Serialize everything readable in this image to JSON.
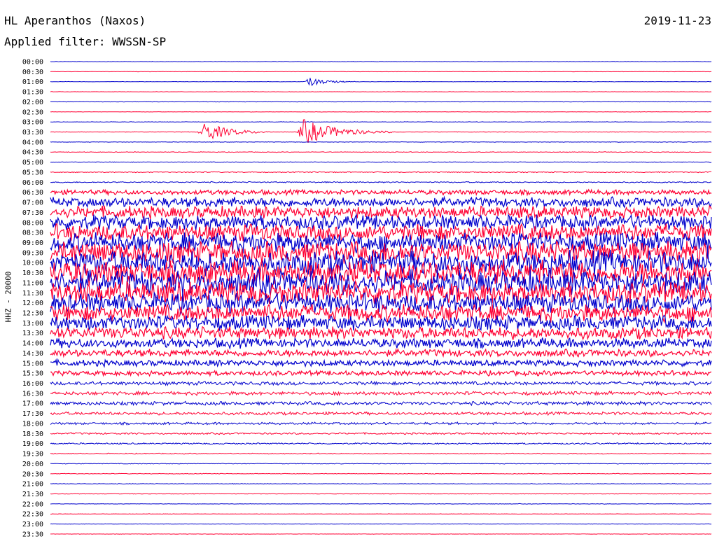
{
  "header": {
    "station": "HL Aperanthos (Naxos)",
    "date": "2019-11-23",
    "filter": "Applied filter: WWSSN-SP"
  },
  "chart_data": {
    "type": "line",
    "title": "HL Aperanthos (Naxos)",
    "ylabel": "HHZ - 20000",
    "row_times": [
      "00:00",
      "00:30",
      "01:00",
      "01:30",
      "02:00",
      "02:30",
      "03:00",
      "03:30",
      "04:00",
      "04:30",
      "05:00",
      "05:30",
      "06:00",
      "06:30",
      "07:00",
      "07:30",
      "08:00",
      "08:30",
      "09:00",
      "09:30",
      "10:00",
      "10:30",
      "11:00",
      "11:30",
      "12:00",
      "12:30",
      "13:00",
      "13:30",
      "14:00",
      "14:30",
      "15:00",
      "15:30",
      "16:00",
      "16:30",
      "17:00",
      "17:30",
      "18:00",
      "18:30",
      "19:00",
      "19:30",
      "20:00",
      "20:30",
      "21:00",
      "21:30",
      "22:00",
      "22:30",
      "23:00",
      "23:30"
    ],
    "trace_colors": [
      "#0000cc",
      "#ff0033"
    ],
    "minutes_per_row": 30,
    "noise_level_by_row": [
      0.3,
      0.3,
      0.3,
      0.3,
      0.3,
      0.3,
      0.4,
      0.4,
      0.4,
      0.5,
      0.6,
      0.8,
      1.0,
      4,
      8,
      10,
      12,
      14,
      16,
      18,
      20,
      20,
      20,
      18,
      16,
      14,
      12,
      10,
      8,
      6,
      5,
      4,
      3,
      3,
      3,
      2.5,
      2,
      1.5,
      1.2,
      0.8,
      0.6,
      0.5,
      0.5,
      0.4,
      0.4,
      0.3,
      0.3,
      0.3
    ],
    "events": [
      {
        "row_time": "03:30",
        "minute": 7.0,
        "amplitude": 14,
        "duration_minutes": 3.0
      },
      {
        "row_time": "03:30",
        "minute": 11.5,
        "amplitude": 18,
        "duration_minutes": 4.0
      },
      {
        "row_time": "01:00",
        "minute": 11.8,
        "amplitude": 6,
        "duration_minutes": 2.0
      }
    ]
  }
}
